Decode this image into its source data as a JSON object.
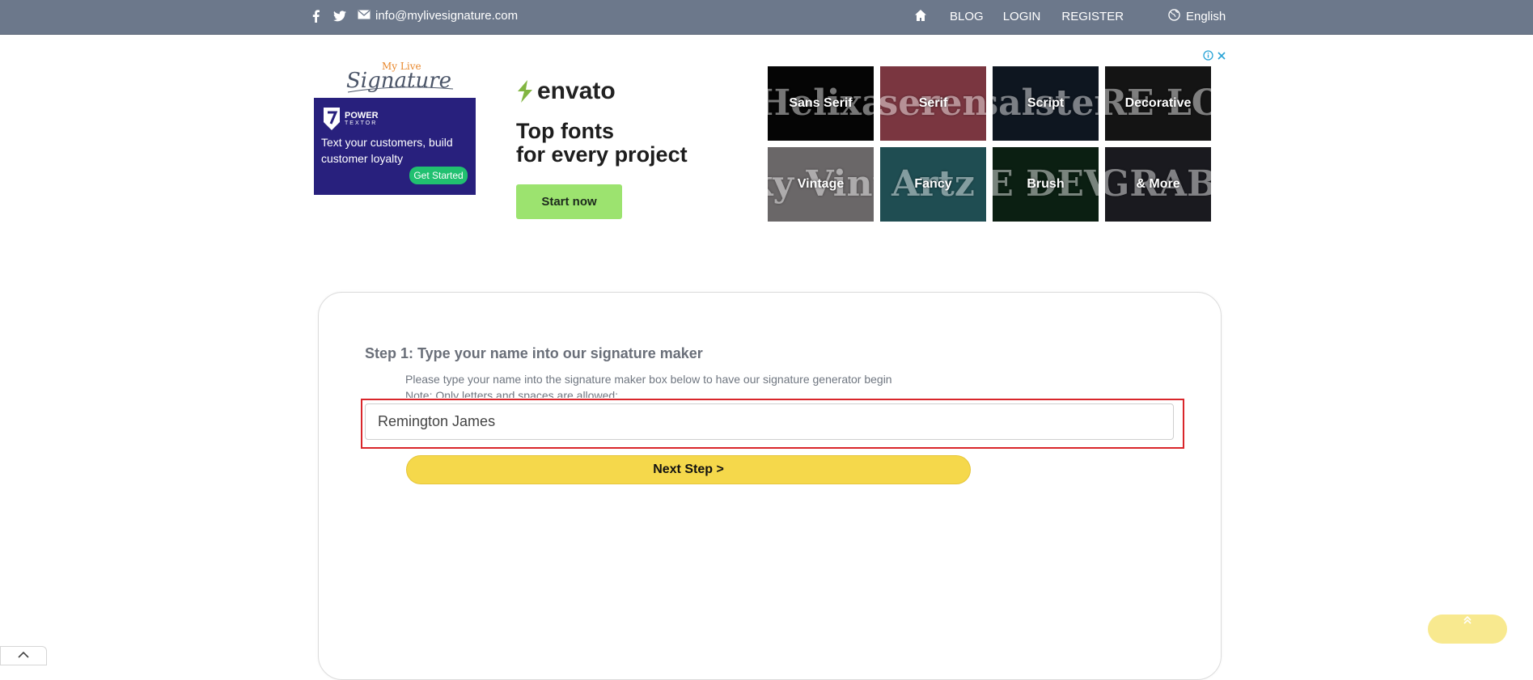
{
  "topbar": {
    "email": "info@mylivesignature.com",
    "nav": {
      "blog": "BLOG",
      "login": "LOGIN",
      "register": "REGISTER"
    },
    "language": "English",
    "icons": [
      "facebook-icon",
      "twitter-icon",
      "mail-icon",
      "home-icon",
      "globe-icon"
    ]
  },
  "logo": {
    "line1": "My Live",
    "line2": "Signature"
  },
  "ad_left": {
    "brand_name": "POWER",
    "brand_sub": "TEXTOR",
    "text": "Text your customers, build customer loyalty",
    "cta": "Get Started"
  },
  "ad_envato": {
    "logo": "envato",
    "headline_line1": "Top fonts",
    "headline_line2": "for every project",
    "cta": "Start now"
  },
  "font_tiles": [
    {
      "label": "Sans Serif",
      "bg_text": "Helixa",
      "bg_color": "#050505"
    },
    {
      "label": "Serif",
      "bg_text": "seren",
      "bg_color": "#7a3640"
    },
    {
      "label": "Script",
      "bg_text": "salster",
      "bg_color": "#0e1620"
    },
    {
      "label": "Decorative",
      "bg_text": "PURE LOVE",
      "bg_color": "#141414"
    },
    {
      "label": "Vintage",
      "bg_text": "Milky Vintage",
      "bg_color": "#6a6768"
    },
    {
      "label": "Fancy",
      "bg_text": "Artz",
      "bg_color": "#1f4d52"
    },
    {
      "label": "Brush",
      "bg_text": "LOVE DEVINE",
      "bg_color": "#0b1f12"
    },
    {
      "label": "& More",
      "bg_text": "GRAB",
      "bg_color": "#1a1a1f"
    }
  ],
  "step1": {
    "title": "Step 1: Type your name into our signature maker",
    "description": "Please type your name into the signature maker box below to have our signature generator begin",
    "note": "Note: Only letters and spaces are allowed:",
    "name_value": "Remington James",
    "next_label": "Next Step >"
  },
  "colors": {
    "topbar": "#6c788b",
    "next_button": "#f5d84b",
    "highlight": "#d9262b",
    "envato_button": "#9ce36f"
  }
}
